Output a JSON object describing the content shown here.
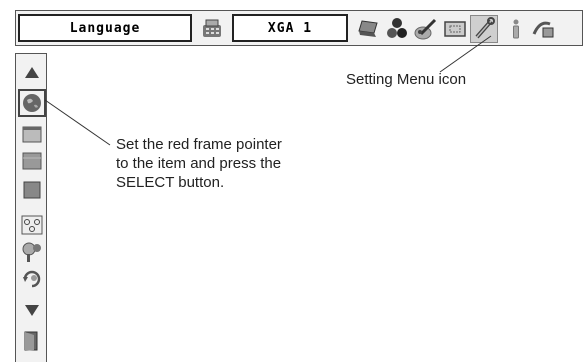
{
  "menubar": {
    "current_item": "Language",
    "signal_mode": "XGA 1",
    "icons": [
      "pc-adjust-icon",
      "laptop-icon",
      "color-balls-icon",
      "brush-icon",
      "screen-icon",
      "setting-icon",
      "info-icon",
      "expand-icon"
    ],
    "selected_icon": "setting-icon"
  },
  "sidebar": {
    "items": [
      "scroll-up-icon",
      "language-globe-icon",
      "window-icon",
      "gray-panel-icon",
      "gray-square-icon",
      "network-icon",
      "key-icon",
      "refresh-icon",
      "scroll-down-icon",
      "exit-door-icon"
    ],
    "framed_item": "language-globe-icon"
  },
  "annotations": {
    "setting_menu_icon": "Setting Menu icon",
    "pointer_instruction": "Set the red frame pointer\nto the item and press the\nSELECT button."
  }
}
